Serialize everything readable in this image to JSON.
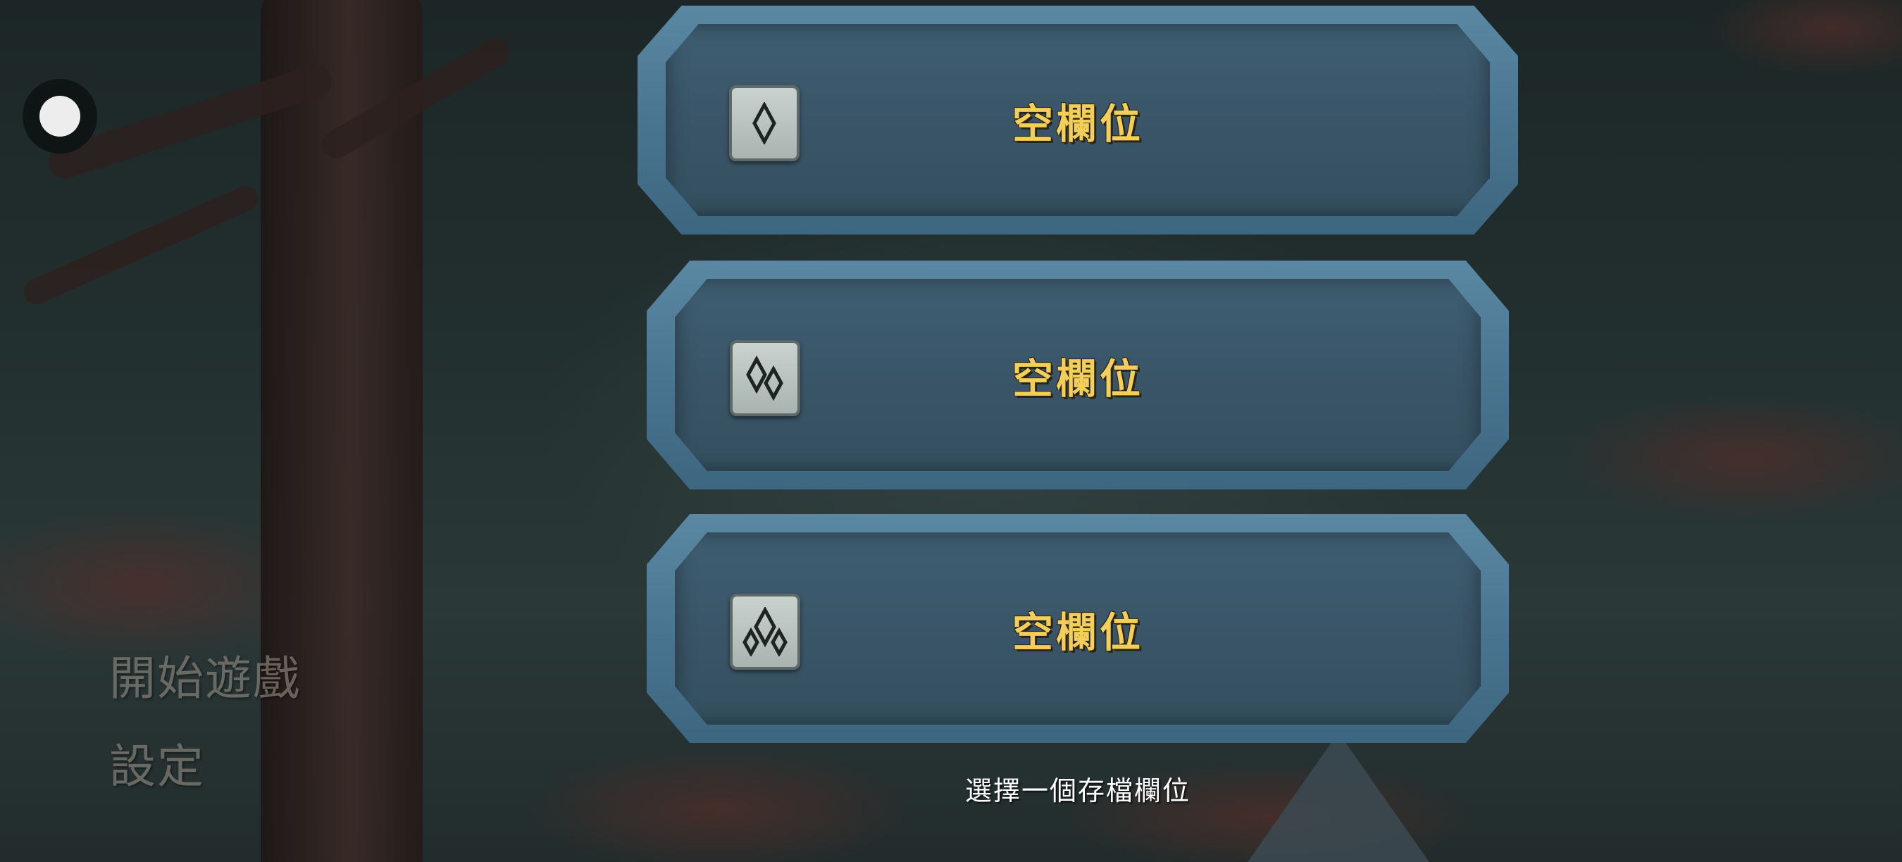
{
  "main_menu": {
    "start_game": "開始遊戲",
    "settings": "設定"
  },
  "save_slots": [
    {
      "label": "空欄位",
      "icon": "single-gem-icon"
    },
    {
      "label": "空欄位",
      "icon": "double-gem-icon"
    },
    {
      "label": "空欄位",
      "icon": "triple-gem-icon"
    }
  ],
  "prompt": "選擇一個存檔欄位",
  "colors": {
    "slot_label": "#f3cf5a",
    "slot_frame": "#4a7590",
    "menu_text": "#8e877e"
  }
}
